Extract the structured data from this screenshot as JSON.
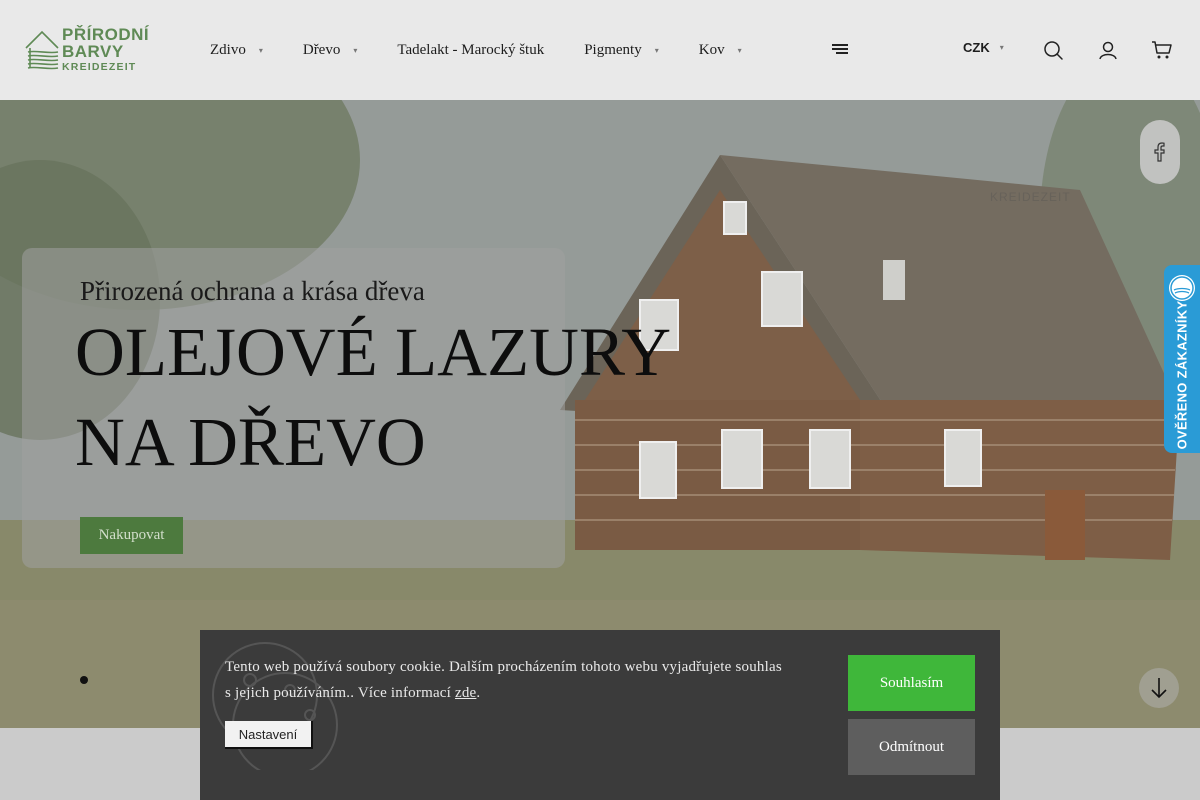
{
  "header": {
    "logo": {
      "line1": "PŘÍRODNÍ",
      "line2": "BARVY",
      "line3": "KREIDEZEIT"
    },
    "nav": [
      {
        "label": "Zdivo",
        "has_dropdown": true
      },
      {
        "label": "Dřevo",
        "has_dropdown": true
      },
      {
        "label": "Tadelakt - Marocký štuk",
        "has_dropdown": false
      },
      {
        "label": "Pigmenty",
        "has_dropdown": true
      },
      {
        "label": "Kov",
        "has_dropdown": true
      }
    ],
    "more_icon": "hamburger-icon",
    "currency": "CZK",
    "icons": [
      "search-icon",
      "user-icon",
      "cart-icon"
    ]
  },
  "hero": {
    "subtitle": "Přirozená ochrana a krása dřeva",
    "title_line1": "OLEJOVÉ LAZURY",
    "title_line2": "NA DŘEVO",
    "button": "Nakupovat",
    "watermark": "KREIDEZEIT",
    "slides_active": 1,
    "social_icon": "facebook-icon",
    "scroll_icon": "arrow-down-icon"
  },
  "verified_badge": {
    "text": "OVĚŘENO ZÁKAZNÍKY"
  },
  "cookie": {
    "text_part1": "Tento web používá soubory cookie. Dalším procházením tohoto webu vyjadřujete souhlas s jejich používáním.. Více informací ",
    "link": "zde",
    "text_part2": ".",
    "settings": "Nastavení",
    "accept": "Souhlasím",
    "decline": "Odmítnout"
  },
  "colors": {
    "brand_green": "#5f8a55",
    "hero_button": "#4d7a3e",
    "accept_green": "#3fb73a",
    "cookie_bg": "#3b3b3b",
    "badge_blue": "#2a9bd6"
  }
}
